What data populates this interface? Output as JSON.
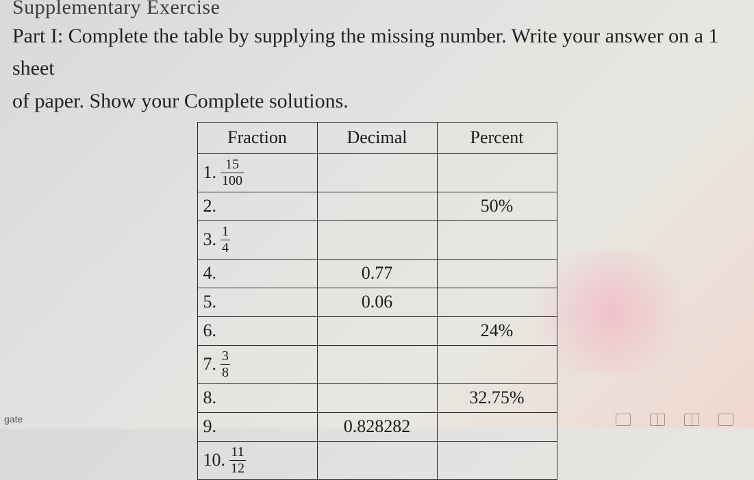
{
  "header": {
    "title": "Supplementary Exercise",
    "instruction_line1": "Part I: Complete the table by supplying the missing number. Write your answer on a 1 sheet",
    "instruction_line2": "of paper. Show your Complete solutions."
  },
  "table": {
    "headers": {
      "fraction": "Fraction",
      "decimal": "Decimal",
      "percent": "Percent"
    },
    "rows": [
      {
        "n": "1.",
        "frac_num": "15",
        "frac_den": "100",
        "decimal": "",
        "percent": ""
      },
      {
        "n": "2.",
        "frac_num": "",
        "frac_den": "",
        "decimal": "",
        "percent": "50%"
      },
      {
        "n": "3.",
        "frac_num": "1",
        "frac_den": "4",
        "decimal": "",
        "percent": ""
      },
      {
        "n": "4.",
        "frac_num": "",
        "frac_den": "",
        "decimal": "0.77",
        "percent": ""
      },
      {
        "n": "5.",
        "frac_num": "",
        "frac_den": "",
        "decimal": "0.06",
        "percent": ""
      },
      {
        "n": "6.",
        "frac_num": "",
        "frac_den": "",
        "decimal": "",
        "percent": "24%"
      },
      {
        "n": "7.",
        "frac_num": "3",
        "frac_den": "8",
        "decimal": "",
        "percent": ""
      },
      {
        "n": "8.",
        "frac_num": "",
        "frac_den": "",
        "decimal": "",
        "percent": "32.75%"
      },
      {
        "n": "9.",
        "frac_num": "",
        "frac_den": "",
        "decimal": "0.828282",
        "percent": ""
      },
      {
        "n": "10.",
        "frac_num": "11",
        "frac_den": "12",
        "decimal": "",
        "percent": ""
      }
    ]
  },
  "corner_label": "gate"
}
